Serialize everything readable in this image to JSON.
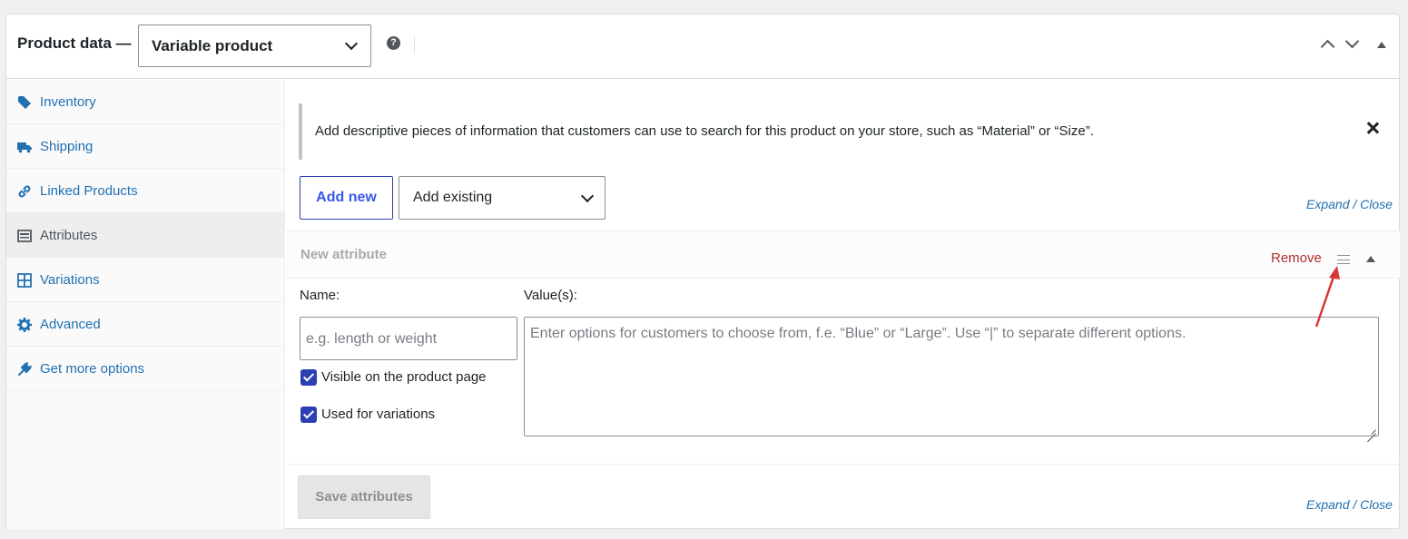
{
  "header": {
    "title": "Product data —",
    "product_type": "Variable product",
    "help": "?"
  },
  "sidebar": {
    "items": [
      {
        "label": "Inventory",
        "icon": "tag-icon"
      },
      {
        "label": "Shipping",
        "icon": "truck-icon"
      },
      {
        "label": "Linked Products",
        "icon": "link-icon"
      },
      {
        "label": "Attributes",
        "icon": "list-view-icon",
        "active": true
      },
      {
        "label": "Variations",
        "icon": "grid-icon"
      },
      {
        "label": "Advanced",
        "icon": "gear-icon"
      },
      {
        "label": "Get more options",
        "icon": "plugin-icon"
      }
    ]
  },
  "notice": {
    "text": "Add descriptive pieces of information that customers can use to search for this product on your store, such as “Material” or “Size”."
  },
  "toolbar": {
    "add_new_label": "Add new",
    "add_existing_label": "Add existing",
    "expand_close_label": "Expand / Close"
  },
  "attribute": {
    "title": "New attribute",
    "remove_label": "Remove",
    "name_label": "Name:",
    "name_placeholder": "e.g. length or weight",
    "values_label": "Value(s):",
    "values_placeholder": "Enter options for customers to choose from, f.e. “Blue” or “Large”. Use “|” to separate different options.",
    "visible_label": "Visible on the product page",
    "visible_checked": true,
    "variations_label": "Used for variations",
    "variations_checked": true
  },
  "footer": {
    "save_label": "Save attributes",
    "expand_close_label": "Expand / Close"
  },
  "colors": {
    "accent": "#2c3fb3",
    "link": "#2271b1",
    "remove": "#b32d2e",
    "annotation_arrow": "#d63638"
  }
}
